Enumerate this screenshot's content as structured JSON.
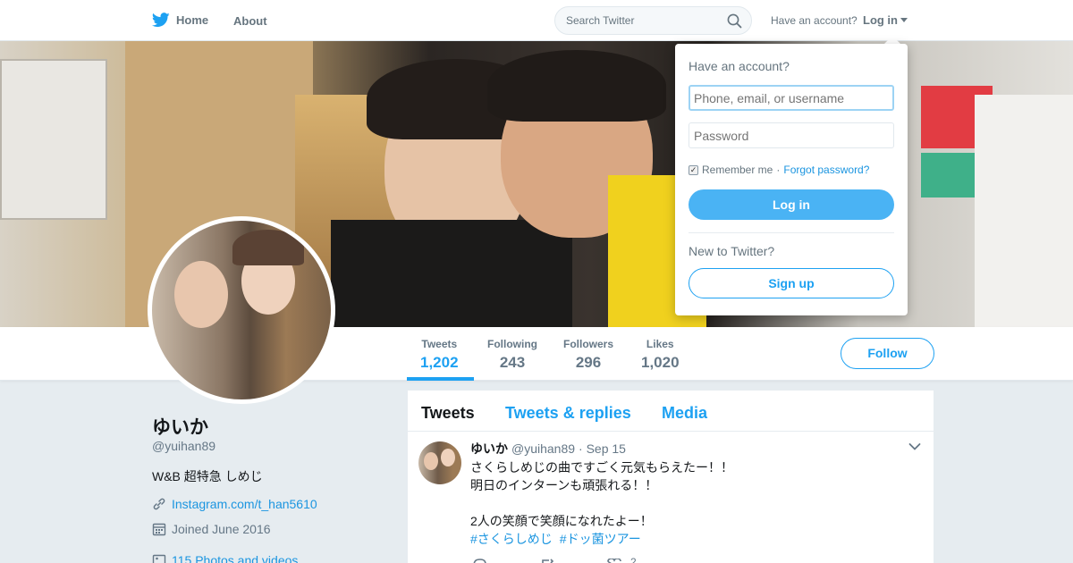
{
  "topbar": {
    "home_label": "Home",
    "about_label": "About",
    "search_placeholder": "Search Twitter",
    "have_account": "Have an account?",
    "login_label": "Log in"
  },
  "profile": {
    "name": "ゆいか",
    "handle": "@yuihan89",
    "bio": "W&B 超特急 しめじ",
    "link": "Instagram.com/t_han5610",
    "joined": "Joined June 2016",
    "media": "115 Photos and videos"
  },
  "stats": [
    {
      "label": "Tweets",
      "value": "1,202"
    },
    {
      "label": "Following",
      "value": "243"
    },
    {
      "label": "Followers",
      "value": "296"
    },
    {
      "label": "Likes",
      "value": "1,020"
    }
  ],
  "follow_label": "Follow",
  "tabs": [
    "Tweets",
    "Tweets & replies",
    "Media"
  ],
  "tweet": {
    "name": "ゆいか",
    "handle": "@yuihan89",
    "date": "· Sep 15",
    "lines": [
      "さくらしめじの曲ですごく元気もらえたー！！",
      "明日のインターンも頑張れる！！",
      "",
      "2人の笑顔で笑顔になれたよー！"
    ],
    "hashtags": [
      "#さくらしめじ",
      "#ドッ菌ツアー"
    ],
    "like_count": "2"
  },
  "login_dropdown": {
    "title": "Have an account?",
    "username_placeholder": "Phone, email, or username",
    "password_placeholder": "Password",
    "remember_me": "Remember me",
    "separator": "·",
    "forgot_password": "Forgot password?",
    "login_button": "Log in",
    "new_to_twitter": "New to Twitter?",
    "signup_button": "Sign up"
  },
  "colors": {
    "accent": "#1da1f2",
    "login_button": "#4ab3f4",
    "page_background": "#e6ecf0"
  }
}
